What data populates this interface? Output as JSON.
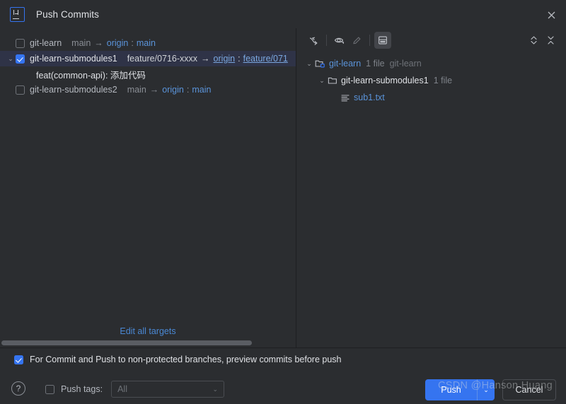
{
  "window": {
    "title": "Push Commits",
    "app_icon": "intellij-idea-icon",
    "close_icon": "close-icon"
  },
  "commit_list": {
    "rows": [
      {
        "repo": "git-learn",
        "local_branch": "main",
        "arrow": "→",
        "remote": "origin",
        "colon": ":",
        "remote_branch": "main",
        "checked": false,
        "selected": false,
        "expandable": false,
        "twisty": "›"
      },
      {
        "repo": "git-learn-submodules1",
        "local_branch": "feature/0716-xxxx",
        "arrow": "→",
        "remote": "origin",
        "colon": ":",
        "remote_branch": "feature/071",
        "checked": true,
        "selected": true,
        "expandable": true,
        "twisty": "⌄"
      },
      {
        "repo": "git-learn-submodules2",
        "local_branch": "main",
        "arrow": "→",
        "remote": "origin",
        "colon": ":",
        "remote_branch": "main",
        "checked": false,
        "selected": false,
        "expandable": false,
        "twisty": "›"
      }
    ],
    "commit_message": "feat(common-api): 添加代码",
    "edit_all_targets": "Edit all targets"
  },
  "changes_toolbar": {
    "group_by_icon": "expand-arrow-icon",
    "preview_icon": "eye-icon",
    "edit_icon": "pencil-icon",
    "layout_icon": "preview-panel-icon",
    "expand_all_icon": "expand-all-icon",
    "collapse_all_icon": "collapse-all-icon"
  },
  "file_tree": {
    "nodes": [
      {
        "label": "git-learn",
        "count": "1 file",
        "path": "git-learn",
        "icon": "module-folder-icon",
        "indent": 0,
        "twisty": "⌄",
        "is_link": true
      },
      {
        "label": "git-learn-submodules1",
        "count": "1 file",
        "path": "",
        "icon": "folder-icon",
        "indent": 1,
        "twisty": "⌄",
        "is_link": false
      },
      {
        "label": "sub1.txt",
        "count": "",
        "path": "",
        "icon": "text-file-icon",
        "indent": 2,
        "twisty": "",
        "is_link": true
      }
    ]
  },
  "options": {
    "preview_checkbox_label": "For Commit and Push to non-protected branches, preview commits before push",
    "preview_checked": true,
    "push_tags_label": "Push tags:",
    "push_tags_checked": false,
    "push_tags_value": "All",
    "push_tags_chevron": "⌄"
  },
  "actions": {
    "help_label": "?",
    "push_label": "Push",
    "push_dropdown_chevron": "⌄",
    "cancel_label": "Cancel"
  },
  "watermark": {
    "text": "CSDN @Hanson Huang"
  },
  "colors": {
    "accent_blue": "#3574f0",
    "link_blue": "#5a93d9",
    "selection_bg": "#2f3347",
    "panel_bg": "#2b2d30",
    "border": "#1e1f22"
  }
}
